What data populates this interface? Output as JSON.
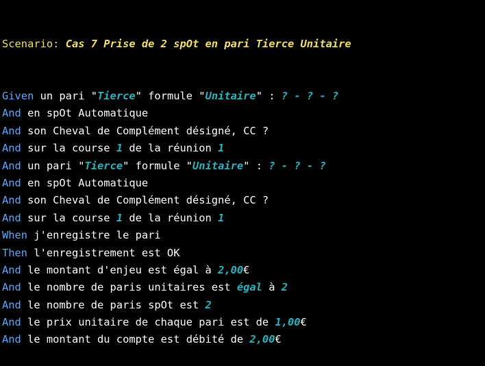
{
  "colors": {
    "background": "#000000",
    "keyword": "#5fa8ff",
    "scenario": "#f0e06a",
    "text": "#ffffff",
    "parameter": "#2bb3c0"
  },
  "scenario": {
    "keyword": "Scenario:",
    "title": "Cas 7 Prise de 2 spOt en pari Tierce Unitaire"
  },
  "steps": [
    {
      "kw": "Given",
      "parts": [
        {
          "t": " un pari \"",
          "p": false
        },
        {
          "t": "Tierce",
          "p": true
        },
        {
          "t": "\" formule \"",
          "p": false
        },
        {
          "t": "Unitaire",
          "p": true
        },
        {
          "t": "\" : ",
          "p": false
        },
        {
          "t": "? - ? - ?",
          "p": true
        }
      ]
    },
    {
      "kw": "And",
      "parts": [
        {
          "t": " en spOt Automatique",
          "p": false
        }
      ]
    },
    {
      "kw": "And",
      "parts": [
        {
          "t": " son Cheval de Complément désigné, CC ?",
          "p": false
        }
      ]
    },
    {
      "kw": "And",
      "parts": [
        {
          "t": " sur la course ",
          "p": false
        },
        {
          "t": "1",
          "p": true
        },
        {
          "t": " de la réunion ",
          "p": false
        },
        {
          "t": "1",
          "p": true
        }
      ]
    },
    {
      "kw": "And",
      "parts": [
        {
          "t": " un pari \"",
          "p": false
        },
        {
          "t": "Tierce",
          "p": true
        },
        {
          "t": "\" formule \"",
          "p": false
        },
        {
          "t": "Unitaire",
          "p": true
        },
        {
          "t": "\" : ",
          "p": false
        },
        {
          "t": "? - ? - ?",
          "p": true
        }
      ]
    },
    {
      "kw": "And",
      "parts": [
        {
          "t": " en spOt Automatique",
          "p": false
        }
      ]
    },
    {
      "kw": "And",
      "parts": [
        {
          "t": " son Cheval de Complément désigné, CC ?",
          "p": false
        }
      ]
    },
    {
      "kw": "And",
      "parts": [
        {
          "t": " sur la course ",
          "p": false
        },
        {
          "t": "1",
          "p": true
        },
        {
          "t": " de la réunion ",
          "p": false
        },
        {
          "t": "1",
          "p": true
        }
      ]
    },
    {
      "kw": "When",
      "parts": [
        {
          "t": " j'enregistre le pari",
          "p": false
        }
      ]
    },
    {
      "kw": "Then",
      "parts": [
        {
          "t": " l'enregistrement est OK",
          "p": false
        }
      ]
    },
    {
      "kw": "And",
      "parts": [
        {
          "t": " le montant d'enjeu est égal à ",
          "p": false
        },
        {
          "t": "2,00",
          "p": true
        },
        {
          "t": "€",
          "p": false
        }
      ]
    },
    {
      "kw": "And",
      "parts": [
        {
          "t": " le nombre de paris unitaires est ",
          "p": false
        },
        {
          "t": "égal",
          "p": true
        },
        {
          "t": " à ",
          "p": false
        },
        {
          "t": "2",
          "p": true
        }
      ]
    },
    {
      "kw": "And",
      "parts": [
        {
          "t": " le nombre de paris spOt est ",
          "p": false
        },
        {
          "t": "2",
          "p": true
        }
      ]
    },
    {
      "kw": "And",
      "parts": [
        {
          "t": " le prix unitaire de chaque pari est de ",
          "p": false
        },
        {
          "t": "1,00",
          "p": true
        },
        {
          "t": "€",
          "p": false
        }
      ]
    },
    {
      "kw": "And",
      "parts": [
        {
          "t": " le montant du compte est débité de ",
          "p": false
        },
        {
          "t": "2,00",
          "p": true
        },
        {
          "t": "€",
          "p": false
        }
      ]
    }
  ]
}
